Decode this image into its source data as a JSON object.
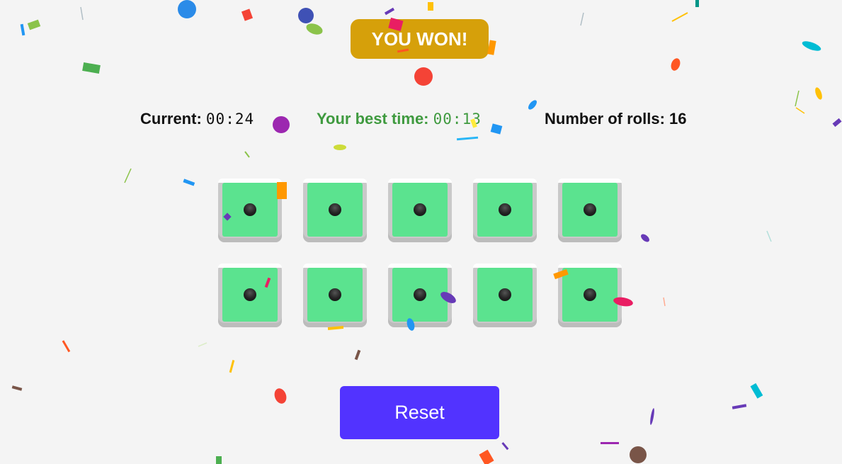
{
  "banner": {
    "text": "YOU WON!"
  },
  "stats": {
    "current_label": "Current:",
    "current_time": "00:24",
    "best_label": "Your best time:",
    "best_time": "00:13",
    "rolls_label": "Number of rolls:",
    "rolls_count": "16"
  },
  "dice": [
    {
      "value": 1,
      "held": true
    },
    {
      "value": 1,
      "held": true
    },
    {
      "value": 1,
      "held": true
    },
    {
      "value": 1,
      "held": true
    },
    {
      "value": 1,
      "held": true
    },
    {
      "value": 1,
      "held": true
    },
    {
      "value": 1,
      "held": true
    },
    {
      "value": 1,
      "held": true
    },
    {
      "value": 1,
      "held": true
    },
    {
      "value": 1,
      "held": true
    }
  ],
  "reset_button": {
    "label": "Reset"
  },
  "colors": {
    "banner": "#d6a00a",
    "held_die_face": "#5be38f",
    "best_time_text": "#3f9a3f",
    "reset_button": "#5233ff",
    "background": "#f4f4f4"
  }
}
